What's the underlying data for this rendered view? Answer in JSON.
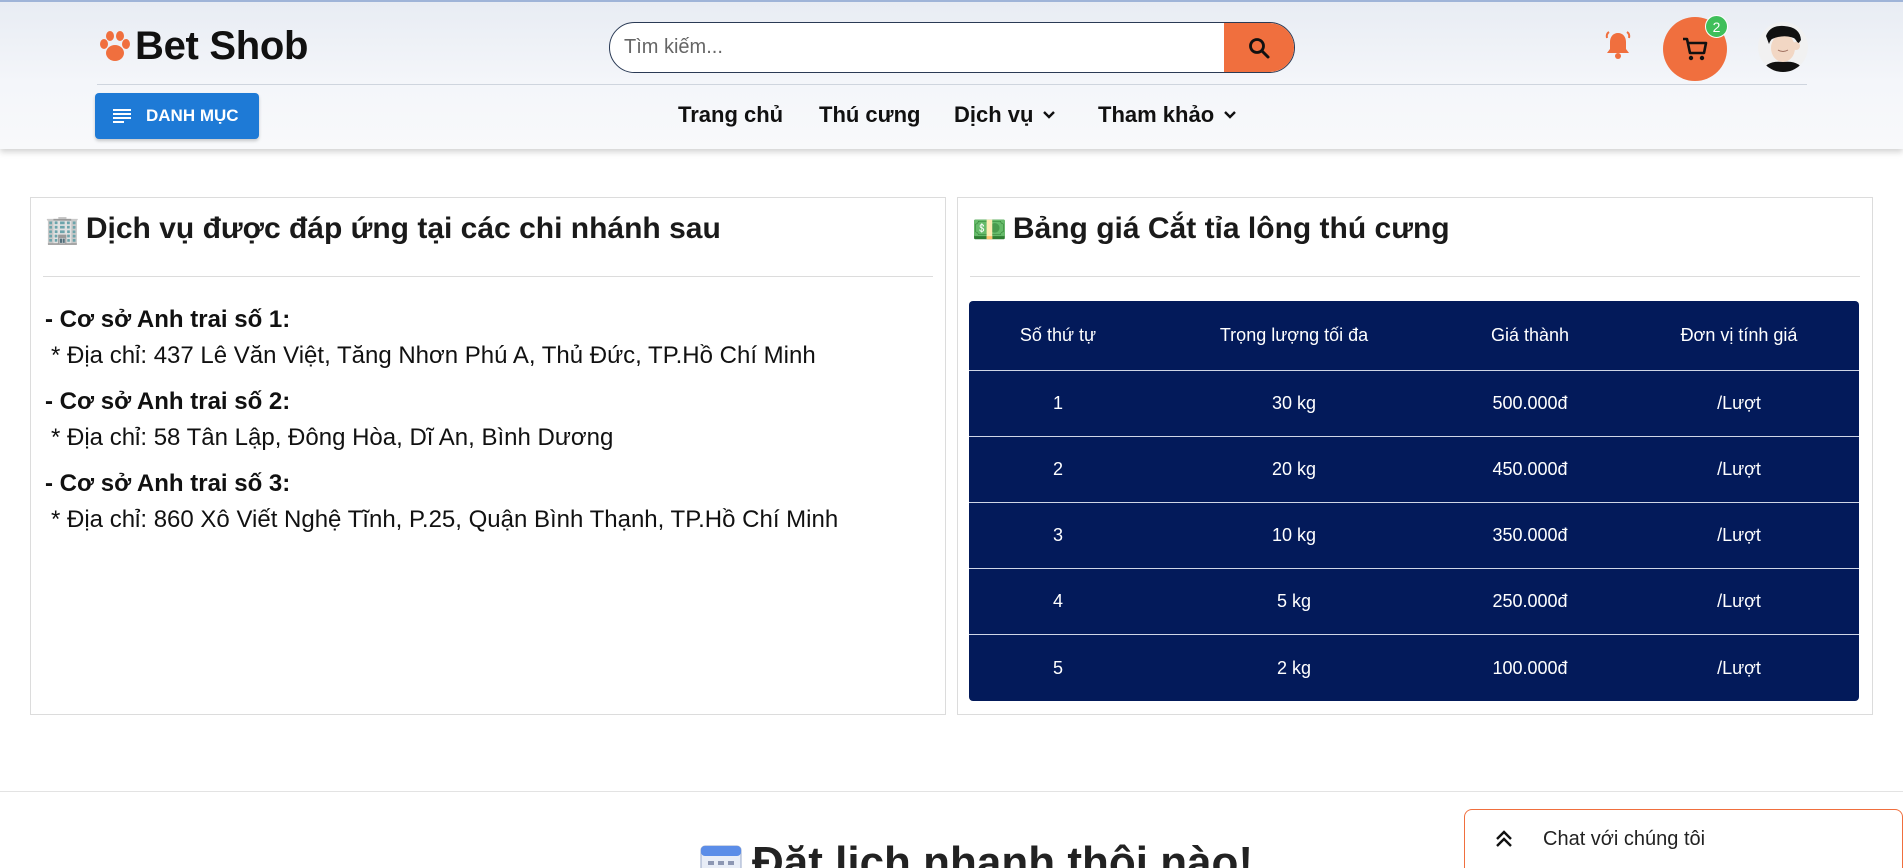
{
  "header": {
    "brand": "Bet Shob",
    "search_placeholder": "Tìm kiếm...",
    "cart_count": "2",
    "menu_button": "DANH MỤC",
    "nav": [
      {
        "label": "Trang chủ",
        "dropdown": false
      },
      {
        "label": "Thú cưng",
        "dropdown": false
      },
      {
        "label": "Dịch vụ",
        "dropdown": true
      },
      {
        "label": "Tham khảo",
        "dropdown": true
      }
    ],
    "icons": {
      "logo": "paw-icon",
      "search": "search-icon",
      "notification": "bell-icon",
      "cart": "cart-icon",
      "menu": "menu-icon",
      "dropdown": "chevron-down-icon"
    },
    "colors": {
      "accent": "#f06f3e",
      "primary": "#1e7ad6",
      "badge": "#3fbf5a"
    }
  },
  "branches_panel": {
    "icon": "🏢",
    "title": "Dịch vụ được đáp ứng tại các chi nhánh sau",
    "branches": [
      {
        "name": "- Cơ sở Anh trai số 1:",
        "address": "* Địa chỉ: 437 Lê Văn Việt, Tăng Nhơn Phú A, Thủ Đức, TP.Hồ Chí Minh"
      },
      {
        "name": "- Cơ sở Anh trai số 2:",
        "address": "* Địa chỉ: 58 Tân Lập, Đông Hòa, Dĩ An, Bình Dương"
      },
      {
        "name": "- Cơ sở Anh trai số 3:",
        "address": "* Địa chỉ: 860 Xô Viết Nghệ Tĩnh, P.25, Quận Bình Thạnh, TP.Hồ Chí Minh"
      }
    ]
  },
  "price_panel": {
    "icon": "💵",
    "title": "Bảng giá Cắt tỉa lông thú cưng",
    "table_color": "#031a5a",
    "headers": [
      "Số thứ tự",
      "Trọng lượng tối đa",
      "Giá thành",
      "Đơn vị tính giá"
    ],
    "rows": [
      [
        "1",
        "30 kg",
        "500.000đ",
        "/Lượt"
      ],
      [
        "2",
        "20 kg",
        "450.000đ",
        "/Lượt"
      ],
      [
        "3",
        "10 kg",
        "350.000đ",
        "/Lượt"
      ],
      [
        "4",
        "5 kg",
        "250.000đ",
        "/Lượt"
      ],
      [
        "5",
        "2 kg",
        "100.000đ",
        "/Lượt"
      ]
    ]
  },
  "booking": {
    "title": "Đặt lịch nhanh thôi nào!",
    "icon": "calendar-icon"
  },
  "chat": {
    "label": "Chat với chúng tôi",
    "icon": "double-chevron-up-icon"
  }
}
